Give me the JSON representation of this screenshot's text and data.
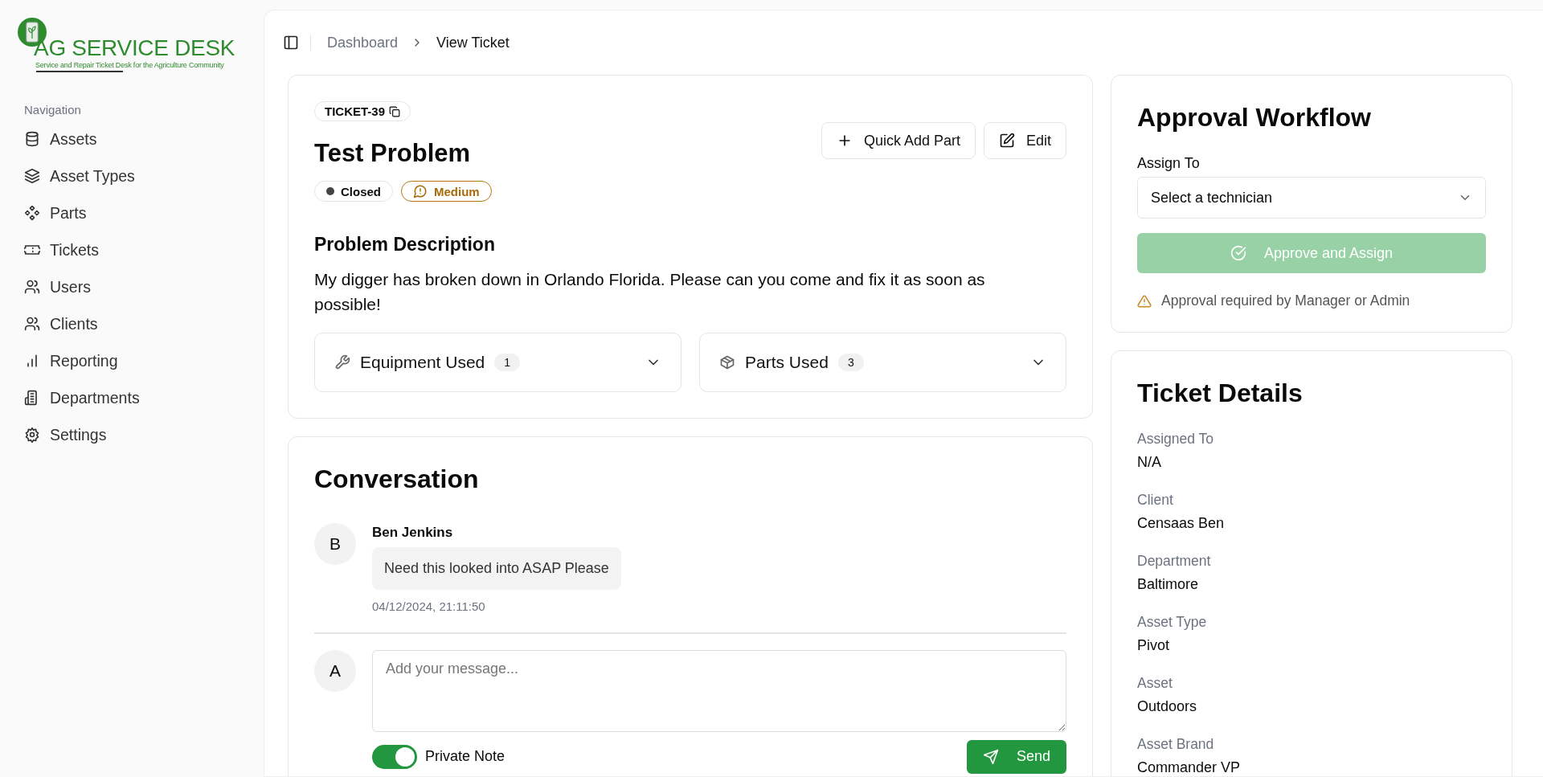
{
  "logo": {
    "title": "AG SERVICE DESK",
    "tagline": "Service and Repair Ticket Desk for the Agriculture Community"
  },
  "sidebar": {
    "section_label": "Navigation",
    "items": [
      {
        "kind": "assets",
        "label": "Assets",
        "selected": false
      },
      {
        "kind": "asset_types",
        "label": "Asset Types",
        "selected": false
      },
      {
        "kind": "parts",
        "label": "Parts",
        "selected": false
      },
      {
        "kind": "tickets",
        "label": "Tickets",
        "selected": false
      },
      {
        "kind": "users",
        "label": "Users",
        "selected": false
      },
      {
        "kind": "clients",
        "label": "Clients",
        "selected": false
      },
      {
        "kind": "reporting",
        "label": "Reporting",
        "selected": false
      },
      {
        "kind": "departments",
        "label": "Departments",
        "selected": false
      },
      {
        "kind": "settings",
        "label": "Settings",
        "selected": false
      }
    ]
  },
  "breadcrumb": [
    {
      "label": "Dashboard",
      "current": false
    },
    {
      "label": "View Ticket",
      "current": true
    }
  ],
  "ticket": {
    "id": "TICKET-39",
    "title": "Test Problem",
    "status": "Closed",
    "priority": "Medium",
    "buttons": [
      {
        "kind": "add",
        "label": "Quick Add Part"
      },
      {
        "kind": "edit",
        "label": "Edit"
      }
    ],
    "description_heading": "Problem Description",
    "description": "My digger has broken down in Orlando Florida. Please can you come and fix it as soon as possible!",
    "sections": [
      {
        "kind": "equipment",
        "label": "Equipment Used",
        "count": "1",
        "expanded": false
      },
      {
        "kind": "parts",
        "label": "Parts Used",
        "count": "3",
        "expanded": false
      }
    ]
  },
  "conversation": {
    "title": "Conversation",
    "messages": [
      {
        "avatar": "B",
        "author": "Ben Jenkins",
        "text": "Need this looked into ASAP Please",
        "time": "04/12/2024, 21:11:50"
      }
    ],
    "composer": {
      "avatar": "A",
      "placeholder": "Add your message...",
      "private_note": {
        "label": "Private Note",
        "on": true
      },
      "send_label": "Send"
    }
  },
  "approval": {
    "title": "Approval Workflow",
    "assign_label": "Assign To",
    "select_placeholder": "Select a technician",
    "approve_button": {
      "label": "Approve and Assign",
      "disabled": true
    },
    "warning": "Approval required by Manager or Admin"
  },
  "details": {
    "title": "Ticket Details",
    "fields": [
      {
        "label": "Assigned To",
        "value": "N/A"
      },
      {
        "label": "Client",
        "value": "Censaas Ben"
      },
      {
        "label": "Department",
        "value": "Baltimore"
      },
      {
        "label": "Asset Type",
        "value": "Pivot"
      },
      {
        "label": "Asset",
        "value": "Outdoors"
      },
      {
        "label": "Asset Brand",
        "value": "Commander VP"
      }
    ]
  }
}
